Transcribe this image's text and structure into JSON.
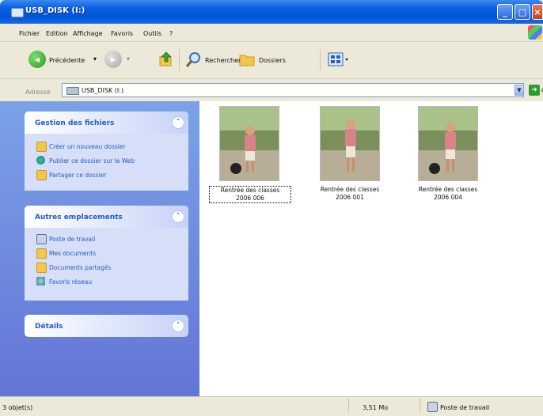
{
  "window": {
    "title": "USB_DISK (I:)"
  },
  "menu": [
    "Fichier",
    "Edition",
    "Affichage",
    "Favoris",
    "Outils",
    "?"
  ],
  "toolbar": {
    "back_label": "Précédente",
    "search_label": "Rechercher",
    "folders_label": "Dossiers"
  },
  "address": {
    "label": "Adresse",
    "value": "USB_DISK (I:)",
    "go_label": "OK"
  },
  "tasks": {
    "file_tasks": {
      "title": "Gestion des fichiers",
      "items": [
        {
          "label": "Créer un nouveau dossier",
          "icon": "new-folder-icon"
        },
        {
          "label": "Publier ce dossier sur le Web",
          "icon": "globe-icon"
        },
        {
          "label": "Partager ce dossier",
          "icon": "share-folder-icon"
        }
      ]
    },
    "other_places": {
      "title": "Autres emplacements",
      "items": [
        {
          "label": "Poste de travail",
          "icon": "computer-icon"
        },
        {
          "label": "Mes documents",
          "icon": "documents-folder-icon"
        },
        {
          "label": "Documents partagés",
          "icon": "shared-folder-icon"
        },
        {
          "label": "Favoris réseau",
          "icon": "network-icon"
        }
      ]
    },
    "details": {
      "title": "Détails"
    }
  },
  "files": [
    {
      "line1": "Rentrée des classes",
      "line2": "2006 006",
      "selected": true
    },
    {
      "line1": "Rentrée des classes",
      "line2": "2006 001",
      "selected": false
    },
    {
      "line1": "Rentrée des classes",
      "line2": "2006 004",
      "selected": false
    }
  ],
  "status": {
    "count": "3 objet(s)",
    "size": "3,51 Mo",
    "location": "Poste de travail"
  },
  "colors": {
    "title_bar": "#0054d8",
    "task_pane": "#6f8ee0",
    "task_text": "#215dc6"
  }
}
